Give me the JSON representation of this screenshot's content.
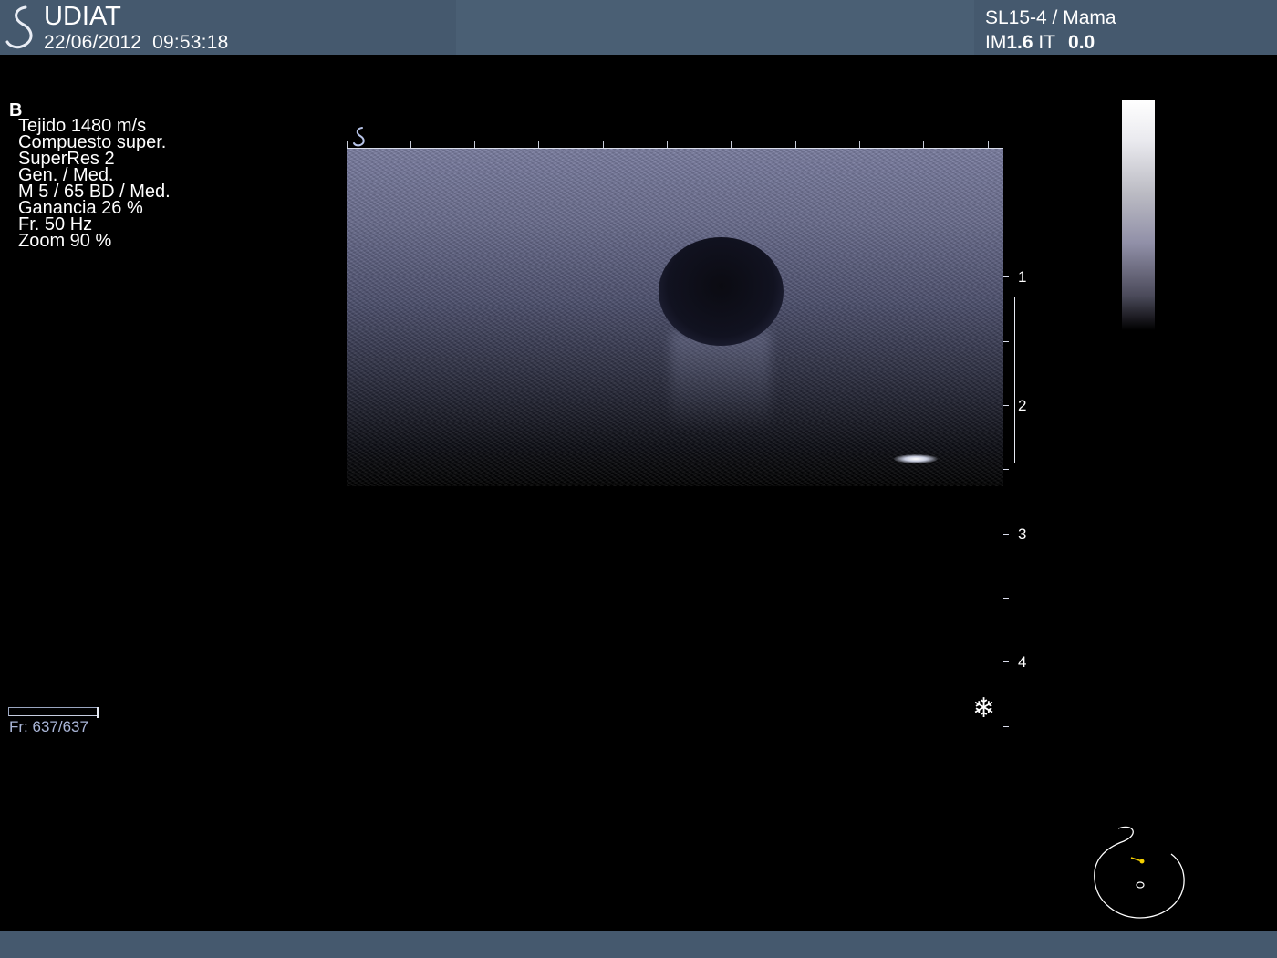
{
  "header": {
    "site_name": "UDIAT",
    "date": "22/06/2012",
    "time": "09:53:18",
    "probe_preset": "SL15-4 / Mama",
    "mi_label": "IM",
    "mi_value": "1.6",
    "ti_label": "IT",
    "ti_value": "0.0"
  },
  "imaging_params": {
    "mode": "B",
    "lines": [
      "Tejido 1480 m/s",
      "Compuesto super.",
      "SuperRes 2",
      "Gen. / Med.",
      "M 5 / 65 BD / Med.",
      "Ganancia 26 %",
      "Fr. 50 Hz",
      "Zoom  90 %"
    ]
  },
  "cine": {
    "frame_text": "Fr: 637/637",
    "progress": 1.0
  },
  "depth_scale": {
    "unit": "cm",
    "labels": [
      "1",
      "2",
      "3",
      "4"
    ]
  },
  "icons": {
    "logo": "udiat-s-logo-icon",
    "freeze": "snowflake-freeze-icon",
    "body_marker": "breast-body-marker-icon"
  },
  "colors": {
    "header_bar": "#45596e",
    "text_primary": "#ffffff",
    "frame_text": "#aab6d8",
    "probe_marker": "#f5d000"
  }
}
